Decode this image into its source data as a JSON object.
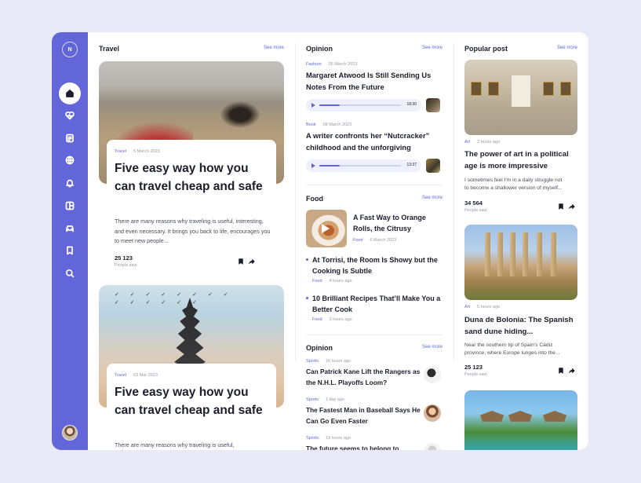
{
  "sidebar": {
    "logo": "N",
    "items": [
      {
        "icon": "home-icon",
        "active": true
      },
      {
        "icon": "heart-pulse-icon"
      },
      {
        "icon": "document-icon"
      },
      {
        "icon": "globe-icon"
      },
      {
        "icon": "bell-icon"
      },
      {
        "icon": "layout-icon"
      },
      {
        "icon": "car-icon"
      },
      {
        "icon": "bookmark-icon"
      },
      {
        "icon": "search-icon"
      }
    ]
  },
  "travel": {
    "title": "Travel",
    "see_more": "See more",
    "cards": [
      {
        "tag": "Travel",
        "date": "5 March 2023",
        "title": "Five easy way how you can travel cheap and safe",
        "text": "There are many reasons why traveling is useful, interesting, and even necessary. It brings you back to life, encourages you to meet new people...",
        "count": "25 123",
        "count_label": "People saw"
      },
      {
        "tag": "Travel",
        "date": "03 Mar 2023",
        "title": "Five easy way how you can travel cheap and safe",
        "text": "There are many reasons why traveling is useful,"
      }
    ]
  },
  "opinion": {
    "title": "Opinion",
    "see_more": "See more",
    "items": [
      {
        "tag": "Fashion",
        "date": "05 March 2023",
        "title": "Margaret Atwood Is Still Sending Us Notes From the Future",
        "time": "18:30",
        "progress": 0.25
      },
      {
        "tag": "Book",
        "date": "08 March 2023",
        "title": "A writer confronts her “Nutcracker” childhood and the unforgiving",
        "time": "13:37",
        "progress": 0.25
      }
    ]
  },
  "food": {
    "title": "Food",
    "see_more": "See more",
    "featured": {
      "title": "A Fast Way to Orange Rolls, the Citrusy",
      "tag": "Food",
      "date": "6 March 2023"
    },
    "items": [
      {
        "title": "At Torrisi, the Room Is Showy but the Cooking Is Subtle",
        "tag": "Food",
        "time": "4 hours ago"
      },
      {
        "title": "10 Brilliant Recipes That’ll Make You a Better Cook",
        "tag": "Food",
        "time": "3 hours ago"
      }
    ]
  },
  "opinion2": {
    "title": "Opinion",
    "see_more": "See more",
    "items": [
      {
        "tag": "Sports",
        "time": "16 hours ago",
        "title": "Can Patrick Kane Lift the Rangers as the N.H.L. Playoffs Loom?"
      },
      {
        "tag": "Sports",
        "time": "1 day ago",
        "title": "The Fastest Man in Baseball Says He Can Go Even Faster"
      },
      {
        "tag": "Sports",
        "time": "19 hours ago",
        "title": "The future seems to belong to"
      }
    ]
  },
  "popular": {
    "title": "Popular post",
    "see_more": "See more",
    "posts": [
      {
        "tag": "Art",
        "time": "2 hours ago",
        "title": "The power of art in a political age is more impressive",
        "text1": "I sometimes feel I'm in a daily struggle not",
        "text2": "to become a shallower version of myself...",
        "count": "34 564",
        "count_label": "People saw"
      },
      {
        "tag": "Art",
        "time": "5 hours ago",
        "title": "Duna de Bolonia: The Spanish sand dune hiding...",
        "text1": "Near the southern tip of Spain's Cádiz",
        "text2": "province, where Europe lunges into the...",
        "count": "25 123",
        "count_label": "People saw"
      }
    ]
  }
}
